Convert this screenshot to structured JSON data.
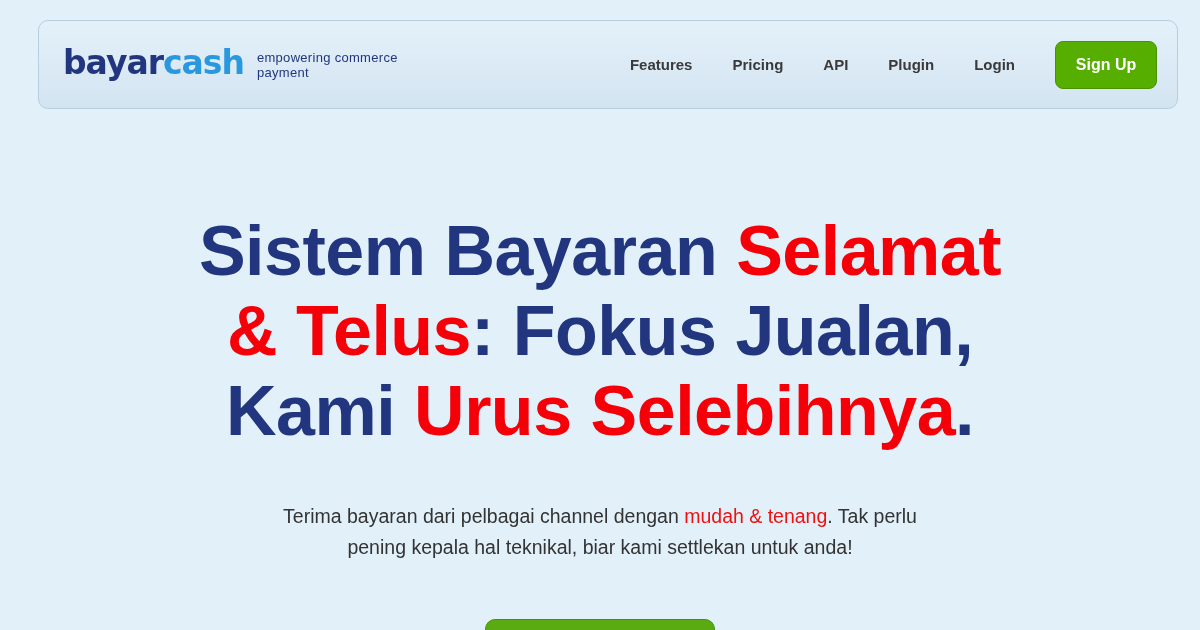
{
  "header": {
    "logo": [
      {
        "text": "bayar",
        "accent": false
      },
      {
        "text": "cash",
        "accent": true
      }
    ],
    "tagline": "empowering commerce payment",
    "nav": [
      {
        "label": "Features"
      },
      {
        "label": "Pricing"
      },
      {
        "label": "API"
      },
      {
        "label": "Plugin"
      },
      {
        "label": "Login"
      }
    ],
    "signup": {
      "label": "Sign Up"
    }
  },
  "hero": {
    "headline": [
      {
        "text": "Sistem Bayaran ",
        "highlight": false
      },
      {
        "text": "Selamat & Telus",
        "highlight": true
      },
      {
        "text": ": Fokus Jualan, Kami ",
        "highlight": false
      },
      {
        "text": "Urus Selebihnya",
        "highlight": true
      },
      {
        "text": ".",
        "highlight": false
      }
    ],
    "subtitle": [
      {
        "text": "Terima bayaran dari pelbagai channel dengan ",
        "highlight": false
      },
      {
        "text": "mudah & tenang",
        "highlight": true
      },
      {
        "text": ". Tak perlu pening kepala hal teknikal, biar kami settlekan untuk anda!",
        "highlight": false
      }
    ]
  }
}
